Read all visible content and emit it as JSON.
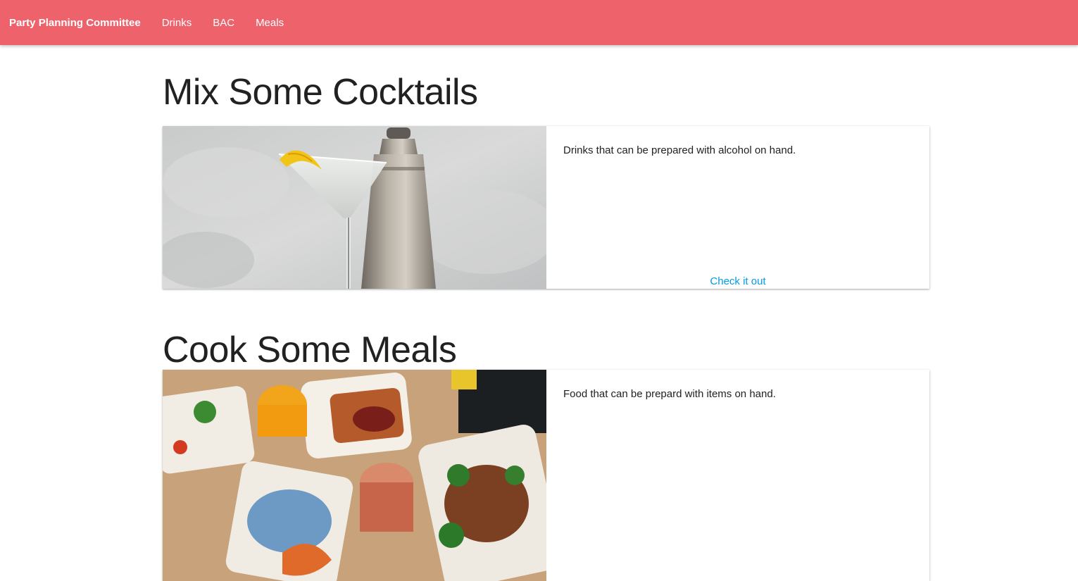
{
  "navbar": {
    "brand": "Party Planning Committee",
    "links": [
      {
        "label": "Drinks"
      },
      {
        "label": "BAC"
      },
      {
        "label": "Meals"
      }
    ],
    "color": "#ee636b"
  },
  "sections": [
    {
      "title": "Mix Some Cocktails",
      "description": "Drinks that can be prepared with alcohol on hand.",
      "action": "Check it out",
      "image_icon": "martini-glass-photo"
    },
    {
      "title": "Cook Some Meals",
      "description": "Food that can be prepard with items on hand.",
      "image_icon": "meal-spread-photo"
    }
  ],
  "colors": {
    "link": "#039be5",
    "text": "#212121"
  }
}
